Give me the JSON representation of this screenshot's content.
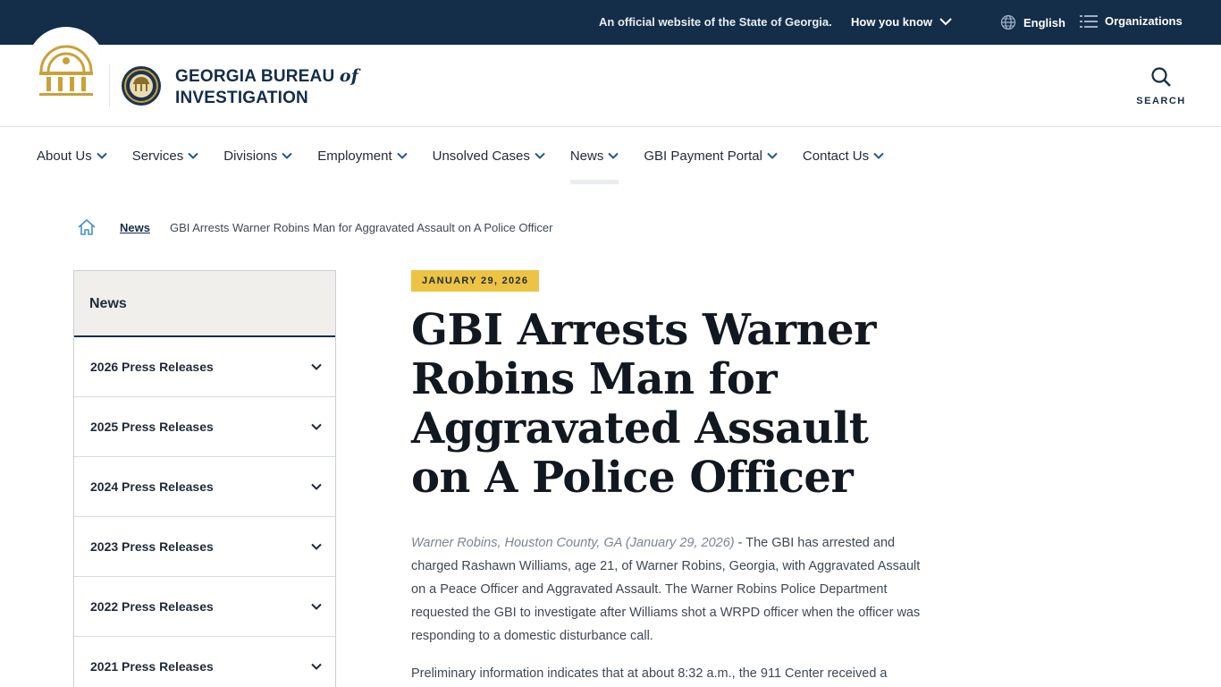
{
  "topbar": {
    "official_text": "An official website of the State of Georgia.",
    "how_you_know": "How you know",
    "language": "English",
    "organizations": "Organizations"
  },
  "header": {
    "agency_line1_prefix": "GEORGIA BUREAU",
    "agency_of": "of",
    "agency_line2": "INVESTIGATION",
    "search_label": "SEARCH"
  },
  "nav": {
    "items": [
      {
        "label": "About Us"
      },
      {
        "label": "Services"
      },
      {
        "label": "Divisions"
      },
      {
        "label": "Employment"
      },
      {
        "label": "Unsolved Cases"
      },
      {
        "label": "News"
      },
      {
        "label": "GBI Payment Portal"
      },
      {
        "label": "Contact Us"
      }
    ]
  },
  "breadcrumb": {
    "link": "News",
    "current": "GBI Arrests Warner Robins Man for Aggravated Assault on A Police Officer"
  },
  "sidebar": {
    "title": "News",
    "items": [
      {
        "label": "2026 Press Releases"
      },
      {
        "label": "2025 Press Releases"
      },
      {
        "label": "2024 Press Releases"
      },
      {
        "label": "2023 Press Releases"
      },
      {
        "label": "2022 Press Releases"
      },
      {
        "label": "2021 Press Releases"
      }
    ]
  },
  "article": {
    "date": "JANUARY 29, 2026",
    "title": "GBI Arrests Warner Robins Man for Aggravated Assault on A Police Officer",
    "dateline": "Warner Robins, Houston County, GA (January 29, 2026)",
    "para1": " - The GBI has arrested and charged Rashawn Williams, age 21, of Warner Robins, Georgia, with Aggravated Assault on a Peace Officer and Aggravated Assault. The Warner Robins Police Department requested the GBI to investigate after Williams shot a WRPD officer when the officer was responding to a domestic disturbance call.",
    "para2": "Preliminary information indicates that at about 8:32 a.m., the 911 Center received a"
  },
  "colors": {
    "navy": "#142d49",
    "gold": "#edc346",
    "seal_gold": "#c9a13a"
  }
}
